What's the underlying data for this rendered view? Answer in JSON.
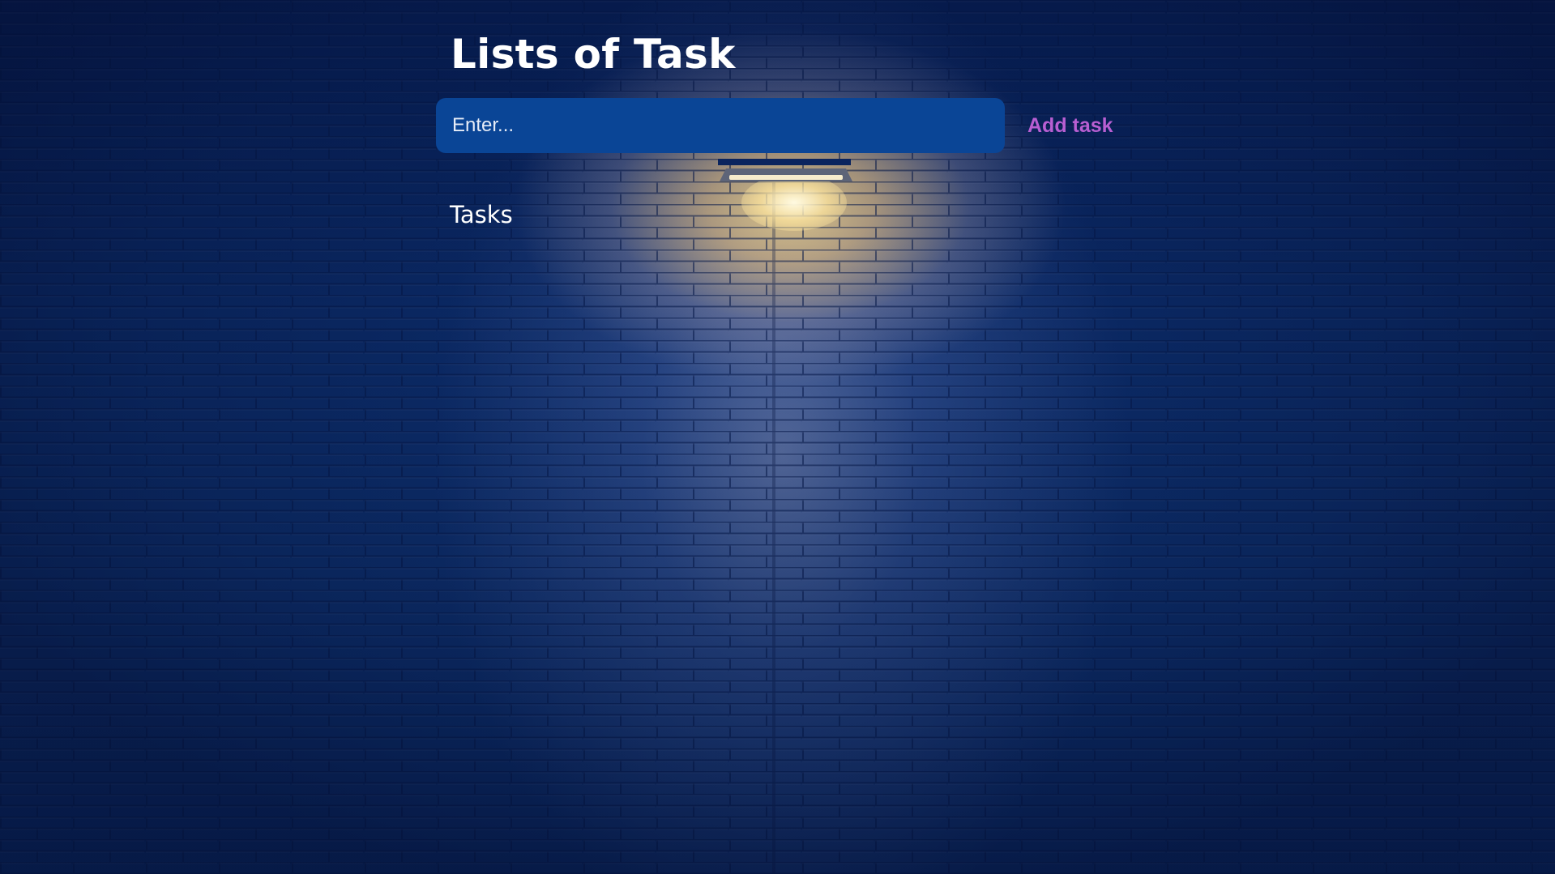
{
  "app": {
    "title": "Lists of Task"
  },
  "input": {
    "placeholder": "Enter...",
    "value": ""
  },
  "add_button": {
    "label": "Add task"
  },
  "tasks": {
    "heading": "Tasks",
    "items": []
  },
  "colors": {
    "input_background": "#0a4596",
    "button_text": "#b85fd2",
    "title_text": "#ffffff",
    "background": "#0b2a66"
  }
}
